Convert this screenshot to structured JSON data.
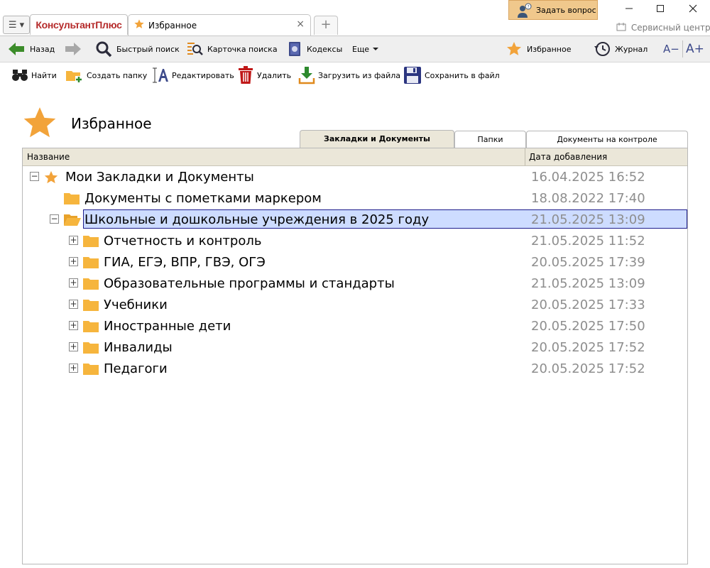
{
  "titlebar": {
    "brand": "КонсультантПлюс",
    "tab_label": "Избранное",
    "tab_close": "×",
    "new_tab": "+",
    "ask_button": "Задать вопрос",
    "service_center": "Сервисный центр",
    "menu_glyph": "☰ ▾"
  },
  "toolbar": {
    "back": "Назад",
    "quick_search": "Быстрый поиск",
    "search_card": "Карточка поиска",
    "codes": "Кодексы",
    "more": "Еще",
    "favorites": "Избранное",
    "journal": "Журнал",
    "font_smaller": "A−",
    "font_bigger": "A+"
  },
  "actions": {
    "find": "Найти",
    "create_folder": "Создать папку",
    "edit": "Редактировать",
    "delete": "Удалить",
    "load_file": "Загрузить из файла",
    "save_file": "Сохранить в файл"
  },
  "page": {
    "title": "Избранное"
  },
  "view_tabs": [
    {
      "label": "Закладки и Документы",
      "active": true
    },
    {
      "label": "Папки",
      "active": false
    },
    {
      "label": "Документы на контроле",
      "active": false
    }
  ],
  "columns": {
    "name": "Название",
    "date": "Дата добавления"
  },
  "tree": [
    {
      "level": 0,
      "icon": "star-icon",
      "toggle": "minus",
      "name": "Мои Закладки и Документы",
      "date": "16.04.2025 16:52"
    },
    {
      "level": 1,
      "icon": "folder-icon",
      "toggle": "none",
      "name": "Документы с пометками маркером",
      "date": "18.08.2022 17:40"
    },
    {
      "level": 1,
      "icon": "folder-open-icon",
      "toggle": "minus",
      "name": "Школьные и дошкольные учреждения в 2025 году",
      "date": "21.05.2025 13:09",
      "selected": true
    },
    {
      "level": 2,
      "icon": "folder-icon",
      "toggle": "plus",
      "name": "Отчетность и контроль",
      "date": "21.05.2025 11:52"
    },
    {
      "level": 2,
      "icon": "folder-icon",
      "toggle": "plus",
      "name": "ГИА, ЕГЭ, ВПР, ГВЭ, ОГЭ",
      "date": "20.05.2025 17:39"
    },
    {
      "level": 2,
      "icon": "folder-icon",
      "toggle": "plus",
      "name": "Образовательные программы и стандарты",
      "date": "21.05.2025 13:09"
    },
    {
      "level": 2,
      "icon": "folder-icon",
      "toggle": "plus",
      "name": "Учебники",
      "date": "20.05.2025 17:33"
    },
    {
      "level": 2,
      "icon": "folder-icon",
      "toggle": "plus",
      "name": "Иностранные дети",
      "date": "20.05.2025 17:50"
    },
    {
      "level": 2,
      "icon": "folder-icon",
      "toggle": "plus",
      "name": "Инвалиды",
      "date": "20.05.2025 17:52"
    },
    {
      "level": 2,
      "icon": "folder-icon",
      "toggle": "plus",
      "name": "Педагоги",
      "date": "20.05.2025 17:52"
    }
  ],
  "colors": {
    "accent_star": "#f2a33a",
    "folder": "#f6b53d",
    "selection": "#cddcff",
    "header_bg": "#ebe7d9",
    "brand": "#b52a2a"
  }
}
